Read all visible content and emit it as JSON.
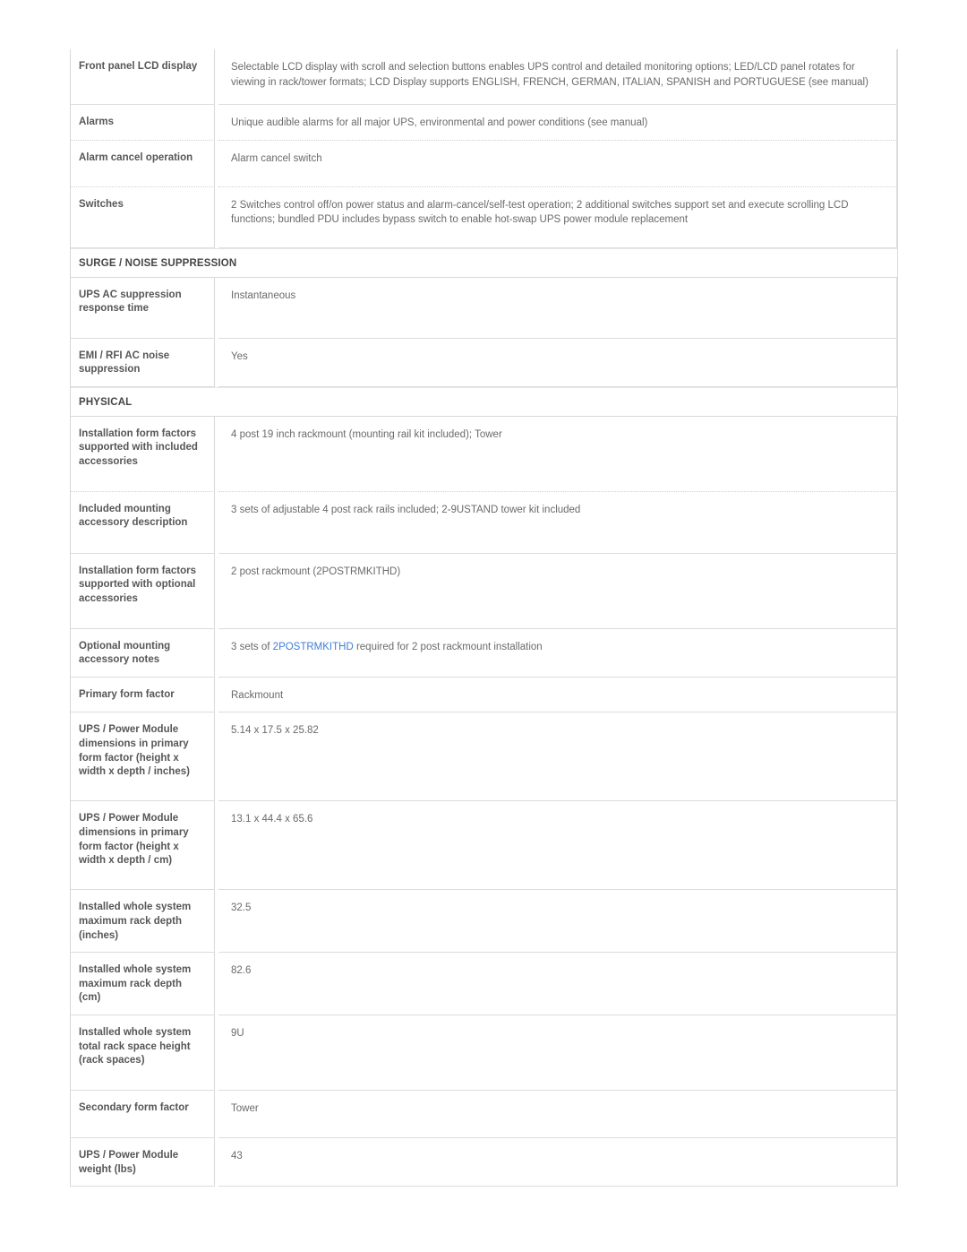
{
  "colors": {
    "label_text": "#575757",
    "value_text": "#6a6a6a",
    "section_text": "#454545",
    "link": "#3d7fd6",
    "border": "#d8d8d8",
    "row_divider": "#d2d2d2",
    "page_background": "#ffffff"
  },
  "blocks": [
    {
      "kind": "row",
      "id": "front-panel-lcd-display",
      "height_class": "h-front-panel",
      "divider": "solid",
      "label": "Front panel LCD display",
      "value": "Selectable LCD display with scroll and selection buttons enables UPS control and detailed monitoring options; LED/LCD panel rotates for viewing in rack/tower formats; LCD Display supports ENGLISH, FRENCH, GERMAN, ITALIAN, SPANISH and PORTUGUESE (see manual)"
    },
    {
      "kind": "row",
      "id": "alarms",
      "height_class": "h-alarms",
      "divider": "dotted",
      "label": "Alarms",
      "value": "Unique audible alarms for all major UPS, environmental and power conditions (see manual)"
    },
    {
      "kind": "row",
      "id": "alarm-cancel-operation",
      "height_class": "h-alarm-cancel",
      "divider": "dotted",
      "label": "Alarm cancel operation",
      "value": "Alarm cancel switch"
    },
    {
      "kind": "row",
      "id": "switches",
      "height_class": "h-switches",
      "divider": "solid",
      "label": "Switches",
      "value": "2 Switches control off/on power status and alarm-cancel/self-test operation; 2 additional switches support set and execute scrolling LCD functions; bundled PDU includes bypass switch to enable hot-swap UPS power module replacement"
    },
    {
      "kind": "section",
      "id": "surge-noise-suppression",
      "label": "SURGE / NOISE SUPPRESSION"
    },
    {
      "kind": "row",
      "id": "ups-ac-suppression-response-time",
      "height_class": "h-ups-ac",
      "divider": "solid",
      "label": "UPS AC suppression response time",
      "value": "Instantaneous"
    },
    {
      "kind": "row",
      "id": "emi-rfi-ac-noise-suppression",
      "height_class": "h-emi",
      "divider": "solid",
      "label": "EMI / RFI AC noise suppression",
      "value": "Yes"
    },
    {
      "kind": "section",
      "id": "physical",
      "label": "PHYSICAL"
    },
    {
      "kind": "row",
      "id": "installation-form-factors-included",
      "height_class": "h-inst-incl",
      "divider": "dotted",
      "label": "Installation form factors supported with included accessories",
      "value": "4 post 19 inch rackmount (mounting rail kit included); Tower"
    },
    {
      "kind": "row",
      "id": "included-mounting-accessory-description",
      "height_class": "h-incl-mount",
      "divider": "solid",
      "label": "Included mounting accessory description",
      "value": "3 sets of adjustable 4 post rack rails included; 2-9USTAND tower kit included"
    },
    {
      "kind": "row",
      "id": "installation-form-factors-optional",
      "height_class": "h-inst-opt",
      "divider": "solid",
      "label": "Installation form factors supported with optional accessories",
      "value": "2 post rackmount (2POSTRMKITHD)"
    },
    {
      "kind": "row",
      "id": "optional-mounting-accessory-notes",
      "height_class": "h-opt-notes",
      "divider": "solid",
      "label": "Optional mounting accessory notes",
      "value_prefix": "3 sets of ",
      "value_link": "2POSTRMKITHD",
      "value_suffix": " required for 2 post rackmount installation"
    },
    {
      "kind": "row",
      "id": "primary-form-factor",
      "height_class": "h-primary",
      "divider": "solid",
      "label": "Primary form factor",
      "value": "Rackmount"
    },
    {
      "kind": "row",
      "id": "ups-power-module-dimensions-inches",
      "height_class": "h-dim-in",
      "divider": "solid",
      "label": "UPS / Power Module dimensions in primary form factor (height x width x depth / inches)",
      "value": "5.14 x 17.5 x 25.82"
    },
    {
      "kind": "row",
      "id": "ups-power-module-dimensions-cm",
      "height_class": "h-dim-cm",
      "divider": "solid",
      "label": "UPS / Power Module dimensions in primary form factor (height x width x depth / cm)",
      "value": "13.1 x 44.4 x 65.6"
    },
    {
      "kind": "row",
      "id": "installed-system-max-rack-depth-inches",
      "height_class": "h-depth-in",
      "divider": "solid",
      "label": "Installed whole system maximum rack depth (inches)",
      "value": "32.5"
    },
    {
      "kind": "row",
      "id": "installed-system-max-rack-depth-cm",
      "height_class": "h-depth-cm",
      "divider": "solid",
      "label": "Installed whole system maximum rack depth (cm)",
      "value": "82.6"
    },
    {
      "kind": "row",
      "id": "installed-system-total-rack-space-height",
      "height_class": "h-rack-u",
      "divider": "solid",
      "label": "Installed whole system total rack space height (rack spaces)",
      "value": "9U"
    },
    {
      "kind": "row",
      "id": "secondary-form-factor",
      "height_class": "h-secondary",
      "divider": "solid",
      "label": "Secondary form factor",
      "value": "Tower"
    },
    {
      "kind": "row",
      "id": "ups-power-module-weight-lbs",
      "height_class": "h-weight",
      "divider": "solid",
      "label": "UPS / Power Module weight (lbs)",
      "value": "43"
    }
  ]
}
